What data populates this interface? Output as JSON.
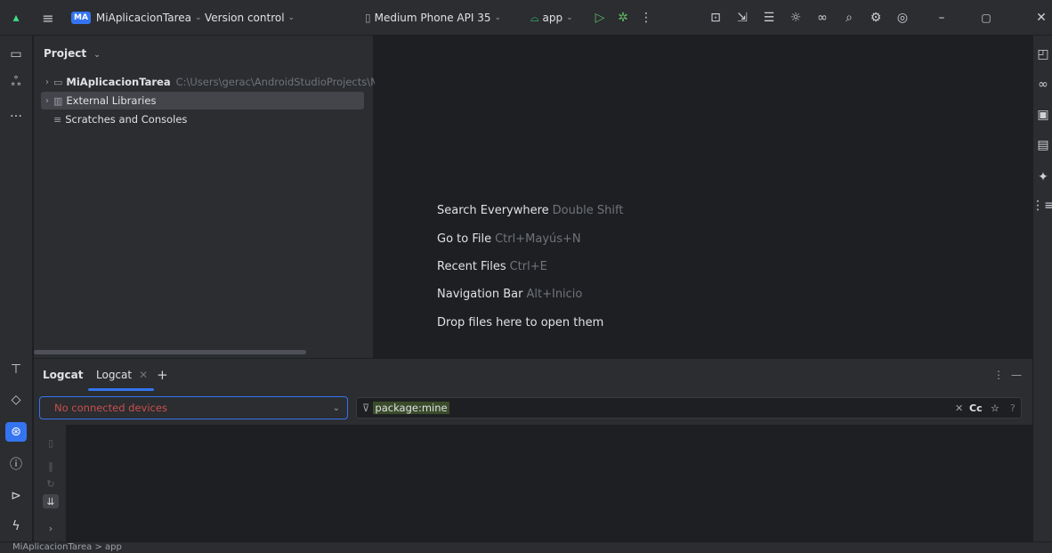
{
  "titlebar": {
    "project_badge": "MA",
    "project_name": "MiAplicacionTarea",
    "version_control": "Version control",
    "device": "Medium Phone API 35",
    "run_config": "app",
    "more": "⋮"
  },
  "project_panel": {
    "title": "Project",
    "tree": [
      {
        "label": "MiAplicacionTarea",
        "path": "C:\\Users\\gerac\\AndroidStudioProjects\\MiA"
      },
      {
        "label": "External Libraries"
      },
      {
        "label": "Scratches and Consoles"
      }
    ]
  },
  "editor": {
    "hints": [
      {
        "action": "Search Everywhere",
        "shortcut": "Double Shift"
      },
      {
        "action": "Go to File",
        "shortcut": "Ctrl+Mayús+N"
      },
      {
        "action": "Recent Files",
        "shortcut": "Ctrl+E"
      },
      {
        "action": "Navigation Bar",
        "shortcut": "Alt+Inicio"
      },
      {
        "action": "Drop files here to open them",
        "shortcut": ""
      }
    ]
  },
  "logcat": {
    "panel_title": "Logcat",
    "tab_label": "Logcat",
    "device_placeholder": "No connected devices",
    "filter_value": "package:mine",
    "match_case": "Cc"
  },
  "statusbar": {
    "breadcrumb": "MiAplicacionTarea  >  app"
  },
  "colors": {
    "accent": "#3574f0",
    "background": "#1e1f22",
    "panel": "#2b2d30",
    "error_text": "#c94f4f"
  }
}
